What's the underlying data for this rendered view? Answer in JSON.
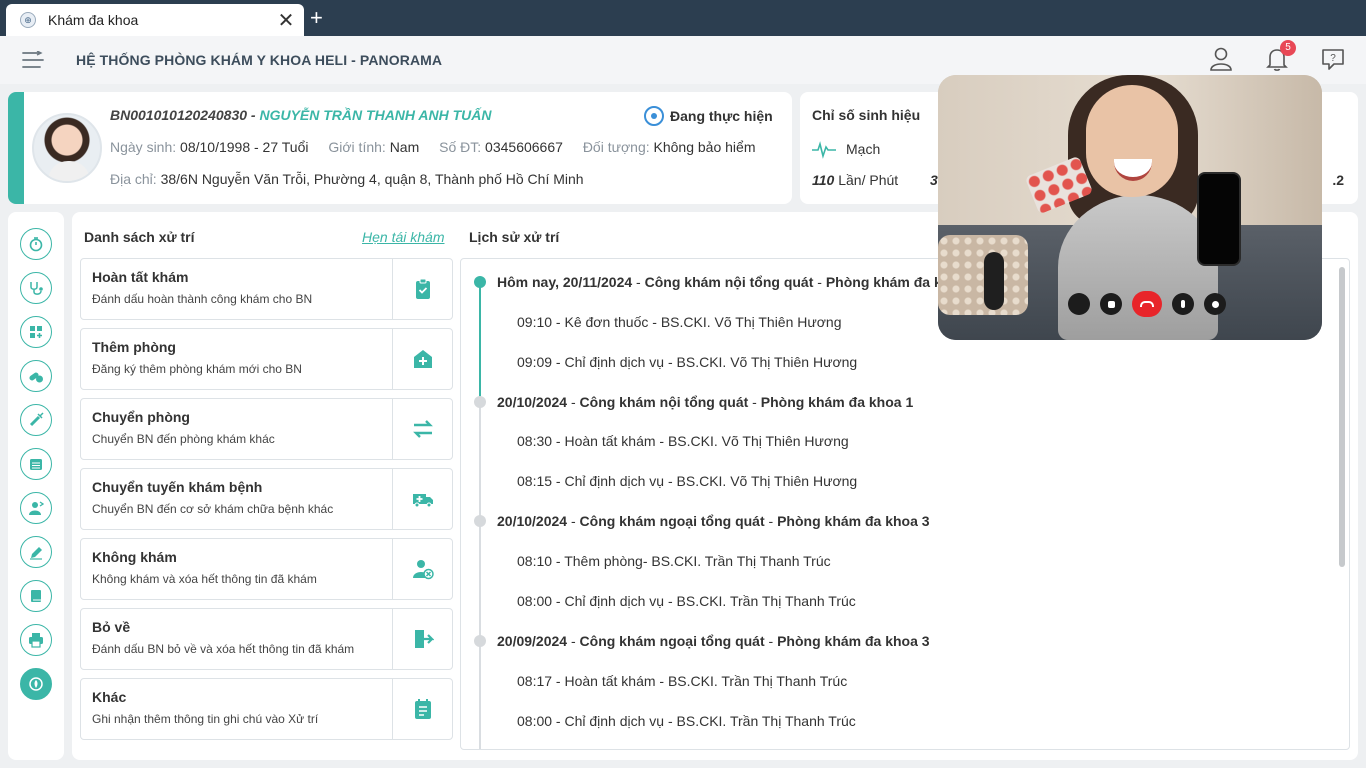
{
  "browser": {
    "tab_title": "Khám đa khoa",
    "new_tab_label": "+",
    "close_label": "✕"
  },
  "header": {
    "app_title": "HỆ THỐNG PHÒNG KHÁM Y KHOA HELI - PANORAMA",
    "notification_count": "5"
  },
  "patient": {
    "id": "BN001010120240830",
    "id_sep": " - ",
    "name": "NGUYỄN TRẦN THANH ANH TUẤN",
    "status": "Đang thực hiện",
    "dob_label": "Ngày sinh:",
    "dob": "08/10/1998 - 27 Tuổi",
    "gender_label": "Giới tính:",
    "gender": "Nam",
    "phone_label": "Số ĐT:",
    "phone": "0345606667",
    "subject_label": "Đối tượng:",
    "subject": "Không bảo hiểm",
    "address_label": "Địa chỉ:",
    "address": "38/6N Nguyễn Văn Trỗi, Phường 4, quận 8, Thành phố Hồ Chí Minh"
  },
  "vitals": {
    "title": "Chỉ số sinh hiệu",
    "pulse_label": "Mạch",
    "pulse_value": "110",
    "pulse_unit": "Lần/ Phút",
    "partial_value": "3",
    "right_partial": ".2"
  },
  "actions_panel": {
    "title": "Danh sách xử trí",
    "link": "Hẹn tái khám"
  },
  "actions": [
    {
      "title": "Hoàn tất khám",
      "desc": "Đánh dấu hoàn thành công khám cho BN",
      "icon": "clipboard-check-icon"
    },
    {
      "title": "Thêm phòng",
      "desc": "Đăng ký thêm phòng khám mới cho BN",
      "icon": "hospital-plus-icon"
    },
    {
      "title": "Chuyển phòng",
      "desc": "Chuyển BN đến phòng khám khác",
      "icon": "swap-arrows-icon"
    },
    {
      "title": "Chuyển tuyến khám bệnh",
      "desc": "Chuyển BN đến cơ sở khám chữa bệnh khác",
      "icon": "ambulance-icon"
    },
    {
      "title": "Không khám",
      "desc": "Không khám và xóa hết thông tin đã khám",
      "icon": "user-remove-icon"
    },
    {
      "title": "Bỏ về",
      "desc": "Đánh dấu BN bỏ về và xóa hết thông tin đã khám",
      "icon": "exit-door-icon"
    },
    {
      "title": "Khác",
      "desc": "Ghi nhận thêm thông tin ghi chú vào Xử trí",
      "icon": "notes-icon"
    }
  ],
  "history_panel": {
    "title": "Lịch sử xử trí"
  },
  "history": [
    {
      "date": "Hôm nay, 20/11/2024",
      "service": "Công khám nội tổng quát",
      "room": "Phòng khám đa khoa 1",
      "items": [
        "09:10 - Kê đơn thuốc - BS.CKI. Võ Thị Thiên Hương",
        "09:09 - Chỉ định dịch vụ - BS.CKI. Võ Thị Thiên Hương"
      ]
    },
    {
      "date": "20/10/2024",
      "service": "Công khám nội tổng quát",
      "room": "Phòng khám đa khoa 1",
      "items": [
        "08:30 - Hoàn tất khám - BS.CKI. Võ Thị Thiên Hương",
        "08:15 - Chỉ định dịch vụ - BS.CKI. Võ Thị Thiên Hương"
      ]
    },
    {
      "date": "20/10/2024",
      "service": "Công khám ngoại tổng quát",
      "room": "Phòng khám đa khoa 3",
      "items": [
        "08:10 - Thêm phòng- BS.CKI. Trần Thị Thanh Trúc",
        "08:00 - Chỉ định dịch vụ - BS.CKI. Trần Thị Thanh Trúc"
      ]
    },
    {
      "date": "20/09/2024",
      "service": "Công khám ngoại tổng quát",
      "room": "Phòng khám đa khoa 3",
      "items": [
        "08:17 - Hoàn tất khám - BS.CKI. Trần Thị Thanh Trúc",
        "08:00 - Chỉ định dịch vụ - BS.CKI. Trần Thị Thanh Trúc"
      ]
    }
  ],
  "rail_icons": [
    "timer-icon",
    "stethoscope-icon",
    "grid-plus-icon",
    "pills-icon",
    "syringe-icon",
    "calendar-icon",
    "user-transfer-icon",
    "edit-document-icon",
    "book-icon",
    "printer-icon",
    "shield-hand-icon"
  ],
  "colors": {
    "accent": "#3bb6a7",
    "badge": "#e84856",
    "tabbar": "#2c3e50",
    "end_call": "#e8252a"
  }
}
